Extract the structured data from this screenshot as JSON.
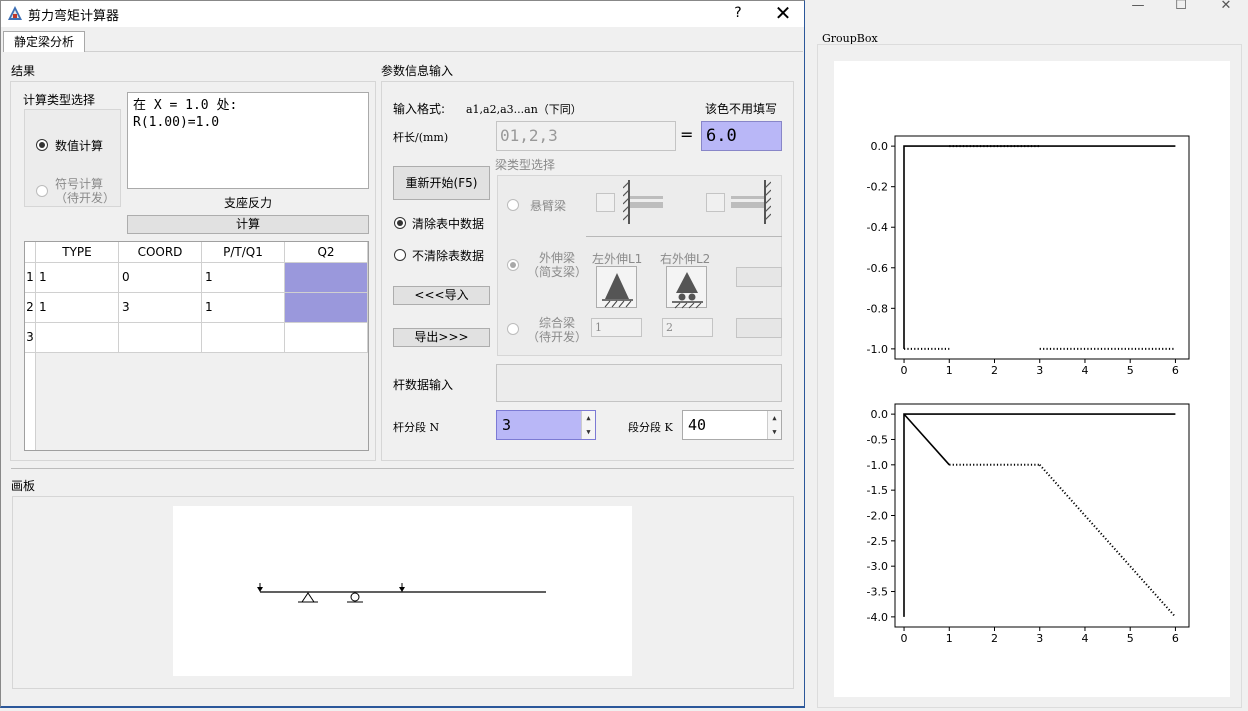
{
  "dialog": {
    "title": "剪力弯矩计算器",
    "help_glyph": "?",
    "close_glyph": "✕"
  },
  "tabs": [
    {
      "label": "静定梁分析"
    }
  ],
  "results": {
    "group_label": "结果",
    "calc_type": {
      "label": "计算类型选择",
      "numeric": "数值计算",
      "symbolic_line1": "符号计算",
      "symbolic_line2": "（待开发）"
    },
    "output_line1": "在 X = 1.0 处:",
    "output_line2": "R(1.00)=1.0",
    "reaction_label": "支座反力",
    "compute_button": "计算",
    "table": {
      "headers": [
        "TYPE",
        "COORD",
        "P/T/Q1",
        "Q2"
      ],
      "rows": [
        {
          "num": "1",
          "type": "1",
          "coord": "0",
          "p": "1",
          "q2": ""
        },
        {
          "num": "2",
          "type": "1",
          "coord": "3",
          "p": "1",
          "q2": ""
        },
        {
          "num": "3",
          "type": "",
          "coord": "",
          "p": "",
          "q2": ""
        }
      ]
    }
  },
  "params": {
    "group_label": "参数信息输入",
    "format_label": "输入格式:",
    "format_hint": "a1,a2,a3...an（下同）",
    "nofill_label": "该色不用填写",
    "length_label": "杆长/(mm)",
    "length_input_placeholder": "01,2,3",
    "equals": "=",
    "length_value": "6.0",
    "restart_button": "重新开始(F5)",
    "clear_radio": "清除表中数据",
    "keep_radio": "不清除表数据",
    "import_button": "<<<导入",
    "export_button": "导出>>>",
    "beam_type": {
      "label": "梁类型选择",
      "cantilever": "悬臂梁",
      "overhang_line1": "外伸梁",
      "overhang_line2": "（简支梁）",
      "left_overhang": "左外伸L1",
      "right_overhang": "右外伸L2",
      "combined_line1": "综合梁",
      "combined_line2": "（待开发）",
      "combined_field1": "1",
      "combined_field2": "2"
    },
    "bar_data_label": "杆数据输入",
    "segments_label": "杆分段 N",
    "segments_value": "3",
    "subseg_label": "段分段 K",
    "subseg_value": "40"
  },
  "canvas": {
    "label": "画板"
  },
  "colors": {
    "highlight": "#b9b7f7",
    "q2_cell": "#9a98dc",
    "accent": "#2b579a"
  },
  "bg_window": {
    "minimize_glyph": "—",
    "maximize_glyph": "☐",
    "close_glyph": "✕",
    "groupbox_title": "GroupBox"
  },
  "chart_data": [
    {
      "type": "line",
      "x_ticks": [
        0,
        1,
        2,
        3,
        4,
        5,
        6
      ],
      "y_ticks": [
        0.0,
        -0.2,
        -0.4,
        -0.6,
        -0.8,
        -1.0
      ],
      "xlim": [
        -0.2,
        6.3
      ],
      "ylim": [
        -1.05,
        0.05
      ],
      "series": [
        {
          "style": "solid",
          "points": [
            [
              0,
              -1.0
            ],
            [
              0,
              0.0
            ],
            [
              6,
              0.0
            ]
          ]
        },
        {
          "style": "dotted",
          "points": [
            [
              0,
              -1.0
            ],
            [
              1,
              -1.0
            ]
          ]
        },
        {
          "style": "dotted",
          "points": [
            [
              1,
              0.0
            ],
            [
              3,
              0.0
            ]
          ]
        },
        {
          "style": "dotted",
          "points": [
            [
              3,
              -1.0
            ],
            [
              6,
              -1.0
            ]
          ]
        }
      ]
    },
    {
      "type": "line",
      "x_ticks": [
        0,
        1,
        2,
        3,
        4,
        5,
        6
      ],
      "y_ticks": [
        0.0,
        -0.5,
        -1.0,
        -1.5,
        -2.0,
        -2.5,
        -3.0,
        -3.5,
        -4.0
      ],
      "xlim": [
        -0.2,
        6.3
      ],
      "ylim": [
        -4.2,
        0.2
      ],
      "series": [
        {
          "style": "solid",
          "points": [
            [
              0,
              -4.0
            ],
            [
              0,
              0.0
            ],
            [
              6,
              0.0
            ]
          ]
        },
        {
          "style": "solid",
          "points": [
            [
              0,
              0.0
            ],
            [
              1,
              -1.0
            ]
          ]
        },
        {
          "style": "dotted",
          "points": [
            [
              1,
              -1.0
            ],
            [
              3,
              -1.0
            ]
          ]
        },
        {
          "style": "dotted",
          "points": [
            [
              3,
              -1.0
            ],
            [
              6,
              -4.0
            ]
          ]
        }
      ]
    }
  ]
}
